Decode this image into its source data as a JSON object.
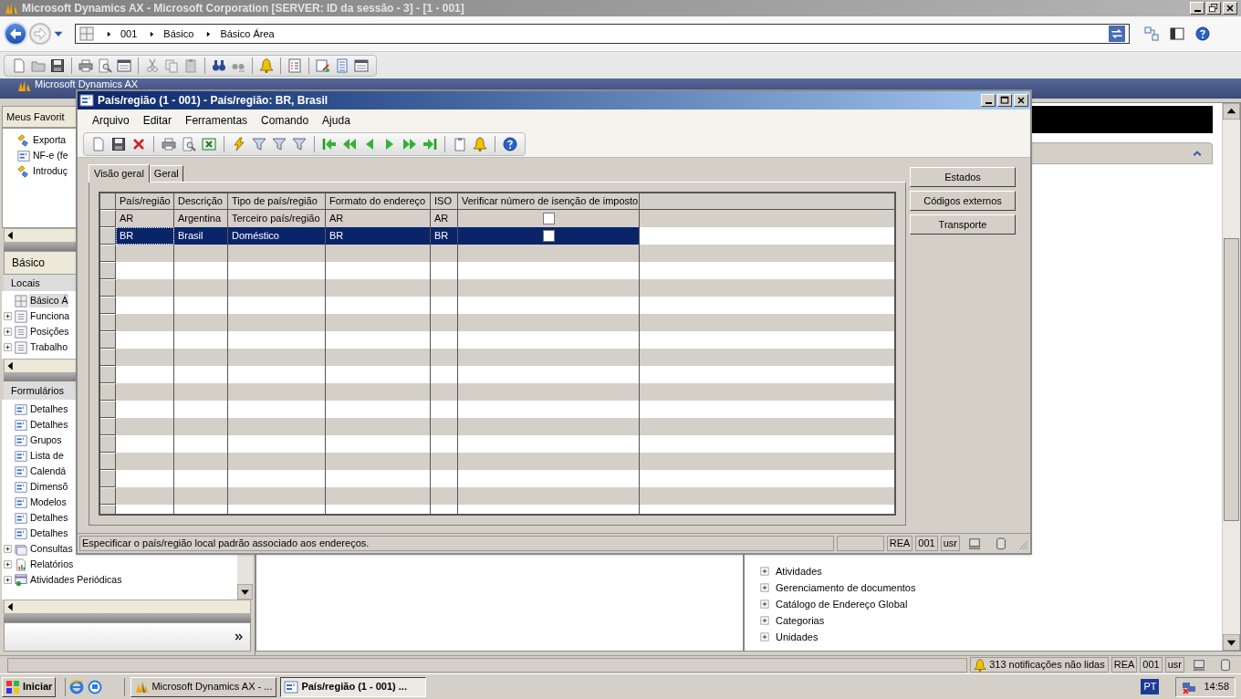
{
  "window": {
    "title": "Microsoft Dynamics AX - Microsoft Corporation [SERVER: ID da sessão - 3] - [1 - 001]"
  },
  "address_bar": {
    "breadcrumb": [
      "001",
      "Básico",
      "Básico Área"
    ]
  },
  "app_menu": {
    "label": "Microsoft Dynamics AX"
  },
  "navigation_pane": {
    "favorites": {
      "title": "Meus Favorit",
      "items": [
        {
          "label": "Exporta",
          "kind": "task"
        },
        {
          "label": "NF-e (fe",
          "kind": "form"
        },
        {
          "label": "Introduç",
          "kind": "task"
        }
      ]
    },
    "module_title": "Básico",
    "places": {
      "title": "Locais",
      "items": [
        {
          "label": "Básico Á",
          "kind": "area",
          "expandable": false,
          "selected": true
        },
        {
          "label": "Funciona",
          "kind": "list",
          "expandable": true,
          "selected": false
        },
        {
          "label": "Posições",
          "kind": "list",
          "expandable": true,
          "selected": false
        },
        {
          "label": "Trabalho",
          "kind": "list",
          "expandable": true,
          "selected": false
        }
      ]
    },
    "forms": {
      "title": "Formulários",
      "items": [
        {
          "label": "Detalhes",
          "kind": "form",
          "expandable": false
        },
        {
          "label": "Detalhes",
          "kind": "form",
          "expandable": false
        },
        {
          "label": "Grupos",
          "kind": "form",
          "expandable": false
        },
        {
          "label": "Lista de",
          "kind": "form",
          "expandable": false
        },
        {
          "label": "Calendá",
          "kind": "form",
          "expandable": false
        },
        {
          "label": "Dimensõ",
          "kind": "form",
          "expandable": false
        },
        {
          "label": "Modelos",
          "kind": "form",
          "expandable": false
        },
        {
          "label": "Detalhes",
          "kind": "form",
          "expandable": false
        },
        {
          "label": "Detalhes",
          "kind": "form",
          "expandable": false
        },
        {
          "label": "Consultas",
          "kind": "query",
          "expandable": true
        },
        {
          "label": "Relatórios",
          "kind": "report",
          "expandable": true
        },
        {
          "label": "Atividades Periódicas",
          "kind": "periodic",
          "expandable": true
        }
      ]
    }
  },
  "content_pane": {
    "tree": [
      {
        "label": "Atividades",
        "expandable": true
      },
      {
        "label": "Gerenciamento de documentos",
        "expandable": true
      },
      {
        "label": "Catálogo de Endereço Global",
        "expandable": true
      },
      {
        "label": "Categorias",
        "expandable": true
      },
      {
        "label": "Unidades",
        "expandable": true
      }
    ]
  },
  "dialog": {
    "title": "País/região (1 - 001) - País/região: BR, Brasil",
    "menu": [
      "Arquivo",
      "Editar",
      "Ferramentas",
      "Comando",
      "Ajuda"
    ],
    "tabs": [
      {
        "label": "Visão geral",
        "selected": true
      },
      {
        "label": "Geral",
        "selected": false
      }
    ],
    "grid": {
      "columns": [
        "País/região",
        "Descrição",
        "Tipo de país/região",
        "Formato do endereço",
        "ISO",
        "Verificar número de isenção de imposto"
      ],
      "rows": [
        {
          "cells": [
            "AR",
            "Argentina",
            "Terceiro país/região",
            "AR",
            "AR"
          ],
          "verify_tax_exempt": false,
          "selected": false
        },
        {
          "cells": [
            "BR",
            "Brasil",
            "Doméstico",
            "BR",
            "BR"
          ],
          "verify_tax_exempt": false,
          "selected": true
        }
      ]
    },
    "buttons": [
      "Estados",
      "Códigos externos",
      "Transporte"
    ],
    "status": {
      "message": "Especificar o país/região local padrão associado aos endereços.",
      "fields": [
        "REA",
        "001",
        "usr"
      ]
    }
  },
  "status_bar": {
    "notifications": "313 notificações não lidas",
    "fields": [
      "REA",
      "001",
      "usr"
    ]
  },
  "taskbar": {
    "start": "Iniciar",
    "tasks": [
      {
        "label": "Microsoft Dynamics AX - ...",
        "selected": false
      },
      {
        "label": "País/região (1 - 001) ...",
        "selected": true
      }
    ],
    "language": "PT",
    "clock": "14:58"
  }
}
